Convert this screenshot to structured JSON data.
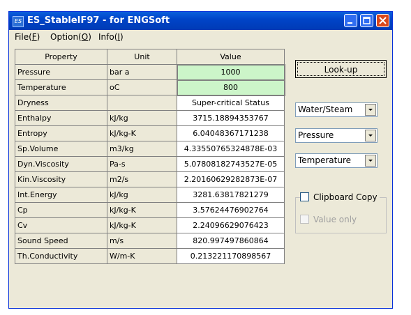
{
  "window": {
    "title": "ES_StableIF97 - for ENGSoft",
    "icon_text": "ES"
  },
  "menu": [
    {
      "label": "File(F)",
      "display": "File(",
      "key": "F",
      "tail": ")"
    },
    {
      "label": "Option(O)",
      "display": "Option(",
      "key": "O",
      "tail": ")"
    },
    {
      "label": "Info(I)",
      "display": "Info(",
      "key": "I",
      "tail": ")"
    }
  ],
  "table": {
    "headers": {
      "property": "Property",
      "unit": "Unit",
      "value": "Value"
    },
    "rows": [
      {
        "property": "Pressure",
        "unit": "bar a",
        "value": "1000"
      },
      {
        "property": "Temperature",
        "unit": "oC",
        "value": "800"
      },
      {
        "property": "Dryness",
        "unit": "",
        "value": "Super-critical Status"
      },
      {
        "property": "Enthalpy",
        "unit": "kJ/kg",
        "value": "3715.18894353767"
      },
      {
        "property": "Entropy",
        "unit": "kJ/kg-K",
        "value": "6.04048367171238"
      },
      {
        "property": "Sp.Volume",
        "unit": "m3/kg",
        "value": "4.33550765324878E-03"
      },
      {
        "property": "Dyn.Viscosity",
        "unit": "Pa-s",
        "value": "5.07808182743527E-05"
      },
      {
        "property": "Kin.Viscosity",
        "unit": "m2/s",
        "value": "2.20160629282873E-07"
      },
      {
        "property": "Int.Energy",
        "unit": "kJ/kg",
        "value": "3281.63817821279"
      },
      {
        "property": "Cp",
        "unit": "kJ/kg-K",
        "value": "3.57624476902764"
      },
      {
        "property": "Cv",
        "unit": "kJ/kg-K",
        "value": "2.24096629076423"
      },
      {
        "property": "Sound Speed",
        "unit": "m/s",
        "value": "820.997497860864"
      },
      {
        "property": "Th.Conductivity",
        "unit": "W/m-K",
        "value": "0.213221170898567"
      }
    ]
  },
  "lookup_button": "Look-up",
  "combos": {
    "fluid": "Water/Steam",
    "input1": "Pressure",
    "input2": "Temperature"
  },
  "options": {
    "clipboard_copy": {
      "label": "Clipboard Copy",
      "checked": false
    },
    "value_only": {
      "label": "Value only",
      "checked": false,
      "enabled": false
    }
  },
  "colors": {
    "input_cell": "#ccf5c9",
    "titlebar": "#0a5fdc",
    "window_bg": "#ece9d8"
  }
}
